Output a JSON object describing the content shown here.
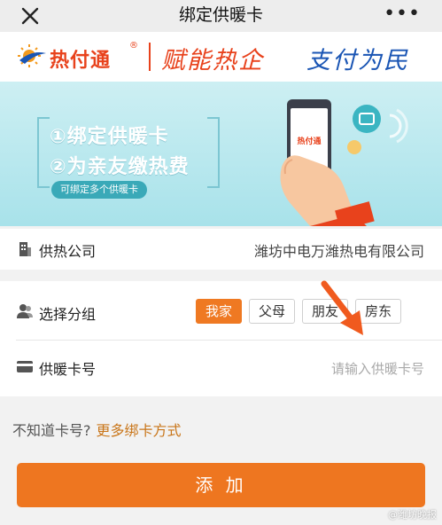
{
  "titlebar": {
    "title": "绑定供暖卡",
    "more": "•••"
  },
  "brand": {
    "logo_text": "热付通",
    "reg": "®",
    "slogan_left": "赋能热企",
    "slogan_right": "支付为民"
  },
  "banner": {
    "line1": "①绑定供暖卡",
    "line2": "②为亲友缴热费",
    "pill": "可绑定多个供暖卡",
    "phone_logo": "热付通"
  },
  "form": {
    "company_label": "供热公司",
    "company_value": "潍坊中电万潍热电有限公司",
    "group_label": "选择分组",
    "groups": [
      "我家",
      "父母",
      "朋友",
      "房东"
    ],
    "group_selected": "我家",
    "card_label": "供暖卡号",
    "card_placeholder": "请输入供暖卡号"
  },
  "help": {
    "question": "不知道卡号?",
    "link": "更多绑卡方式"
  },
  "add_button": "添 加",
  "watermark": "@潍坊晚报",
  "colors": {
    "accent": "#ee7620",
    "brand_red": "#e8421c",
    "brand_blue": "#1a55b4",
    "banner_bg": "#bfe9ef"
  }
}
